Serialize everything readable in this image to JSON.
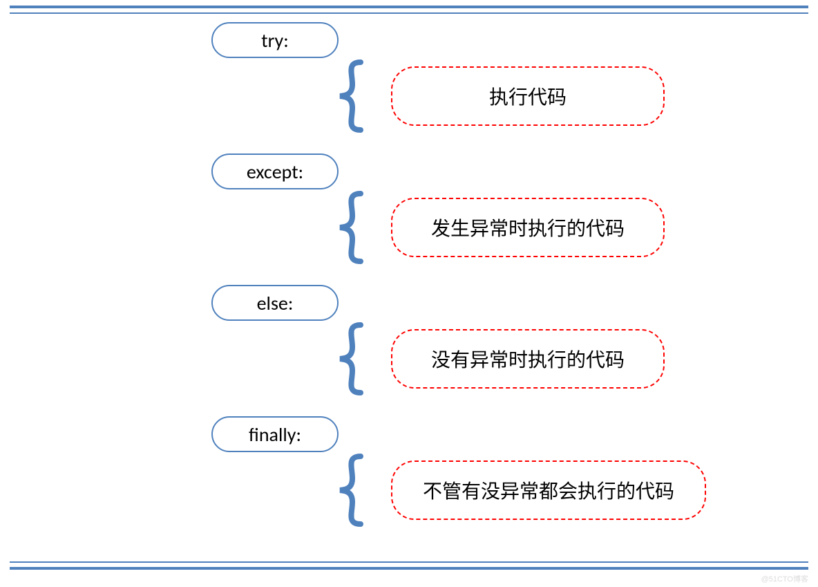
{
  "colors": {
    "blue": "#4f81bd",
    "red": "#ff0000"
  },
  "watermark": "@51CTO博客",
  "blocks": [
    {
      "keyword": "try:",
      "description": "执行代码"
    },
    {
      "keyword": "except:",
      "description": "发生异常时执行的代码"
    },
    {
      "keyword": "else:",
      "description": "没有异常时执行的代码"
    },
    {
      "keyword": "finally:",
      "description": "不管有没异常都会执行的代码"
    }
  ]
}
